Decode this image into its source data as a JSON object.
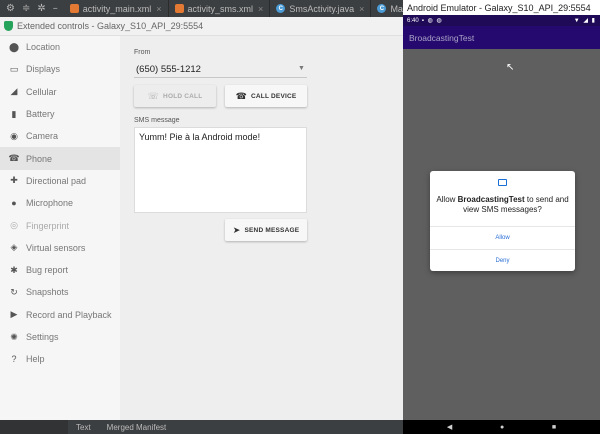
{
  "ide": {
    "tool_icons": [
      "gear-icon",
      "split-icon",
      "settings-icon",
      "minimize-icon"
    ],
    "tabs": [
      {
        "label": "activity_main.xml",
        "type": "xml"
      },
      {
        "label": "activity_sms.xml",
        "type": "xml"
      },
      {
        "label": "SmsActivity.java",
        "type": "java"
      },
      {
        "label": "MainActivity.java",
        "type": "java"
      }
    ],
    "bottom_tabs": [
      "Text",
      "Merged Manifest"
    ]
  },
  "extended_controls": {
    "title": "Extended controls - Galaxy_S10_API_29:5554",
    "sidebar": [
      {
        "label": "Location",
        "icon": "location-pin-icon",
        "glyph": "⬤",
        "state": "normal"
      },
      {
        "label": "Displays",
        "icon": "display-icon",
        "glyph": "▭",
        "state": "normal"
      },
      {
        "label": "Cellular",
        "icon": "signal-icon",
        "glyph": "◢",
        "state": "normal"
      },
      {
        "label": "Battery",
        "icon": "battery-icon",
        "glyph": "▮",
        "state": "normal"
      },
      {
        "label": "Camera",
        "icon": "camera-icon",
        "glyph": "◉",
        "state": "normal"
      },
      {
        "label": "Phone",
        "icon": "phone-icon",
        "glyph": "☎",
        "state": "active"
      },
      {
        "label": "Directional pad",
        "icon": "dpad-icon",
        "glyph": "✚",
        "state": "normal"
      },
      {
        "label": "Microphone",
        "icon": "microphone-icon",
        "glyph": "●",
        "state": "normal"
      },
      {
        "label": "Fingerprint",
        "icon": "fingerprint-icon",
        "glyph": "◎",
        "state": "dim"
      },
      {
        "label": "Virtual sensors",
        "icon": "sensors-icon",
        "glyph": "◈",
        "state": "normal"
      },
      {
        "label": "Bug report",
        "icon": "bug-icon",
        "glyph": "✱",
        "state": "normal"
      },
      {
        "label": "Snapshots",
        "icon": "snapshots-icon",
        "glyph": "↻",
        "state": "normal"
      },
      {
        "label": "Record and Playback",
        "icon": "record-icon",
        "glyph": "▶",
        "state": "normal"
      },
      {
        "label": "Settings",
        "icon": "gear-icon",
        "glyph": "✺",
        "state": "normal"
      },
      {
        "label": "Help",
        "icon": "help-icon",
        "glyph": "?",
        "state": "normal"
      }
    ],
    "phone": {
      "from_label": "From",
      "from_value": "(650) 555-1212",
      "hold_call_label": "HOLD CALL",
      "call_device_label": "CALL DEVICE",
      "sms_label": "SMS message",
      "sms_value": "Yumm! Pie à la Android mode!",
      "send_message_label": "SEND MESSAGE"
    }
  },
  "emulator": {
    "title": "Android Emulator - Galaxy_S10_API_29:5554",
    "status_time": "6:40",
    "app_title": "BroadcastingTest",
    "dialog": {
      "text_before": "Allow ",
      "app_name": "BroadcastingTest",
      "text_after": " to send and view SMS messages?",
      "allow_label": "Allow",
      "deny_label": "Deny"
    }
  },
  "colors": {
    "status_bar": "#1f0a58",
    "app_bar": "#26096e",
    "dialog_button": "#2a6fd6",
    "ide_background": "#3c3f41"
  }
}
